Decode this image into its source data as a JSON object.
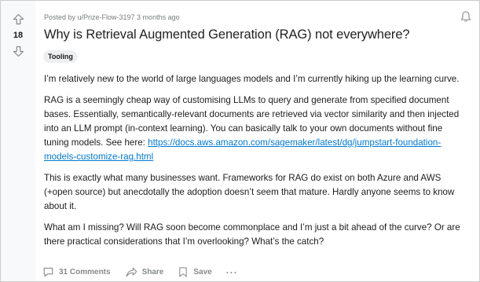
{
  "post": {
    "meta": "Posted by u/Prize-Flow-3197 3 months ago",
    "score": "18",
    "title": "Why is Retrieval Augmented Generation (RAG) not everywhere?",
    "flair": "Tooling",
    "paragraphs": {
      "p1": "I’m relatively new to the world of large languages models and I’m currently hiking up the learning curve.",
      "p2_text": "RAG is a seemingly cheap way of customising LLMs to query and generate from specified document bases. Essentially, semantically-relevant documents are retrieved via vector similarity and then injected into an LLM prompt (in-context learning). You can basically talk to your own documents without fine tuning models. See here: ",
      "p2_link": "https://docs.aws.amazon.com/sagemaker/latest/dg/jumpstart-foundation-models-customize-rag.html",
      "p3": "This is exactly what many businesses want. Frameworks for RAG do exist on both Azure and AWS (+open source) but anecdotally the adoption doesn’t seem that mature. Hardly anyone seems to know about it.",
      "p4": "What am I missing? Will RAG soon become commonplace and I’m just a bit ahead of the curve? Or are there practical considerations that I’m overlooking? What’s the catch?"
    }
  },
  "actions": {
    "comments": "31 Comments",
    "share": "Share",
    "save": "Save",
    "more": "···"
  },
  "icons": {
    "upvote": "upvote-arrow-icon",
    "downvote": "downvote-arrow-icon",
    "bell": "bell-icon",
    "comment": "comment-bubble-icon",
    "share": "share-arrow-icon",
    "save": "bookmark-icon"
  },
  "colors": {
    "link": "#0079d3",
    "meta": "#787c7e",
    "actions": "#878a8c",
    "flair_bg": "#edeff1"
  }
}
